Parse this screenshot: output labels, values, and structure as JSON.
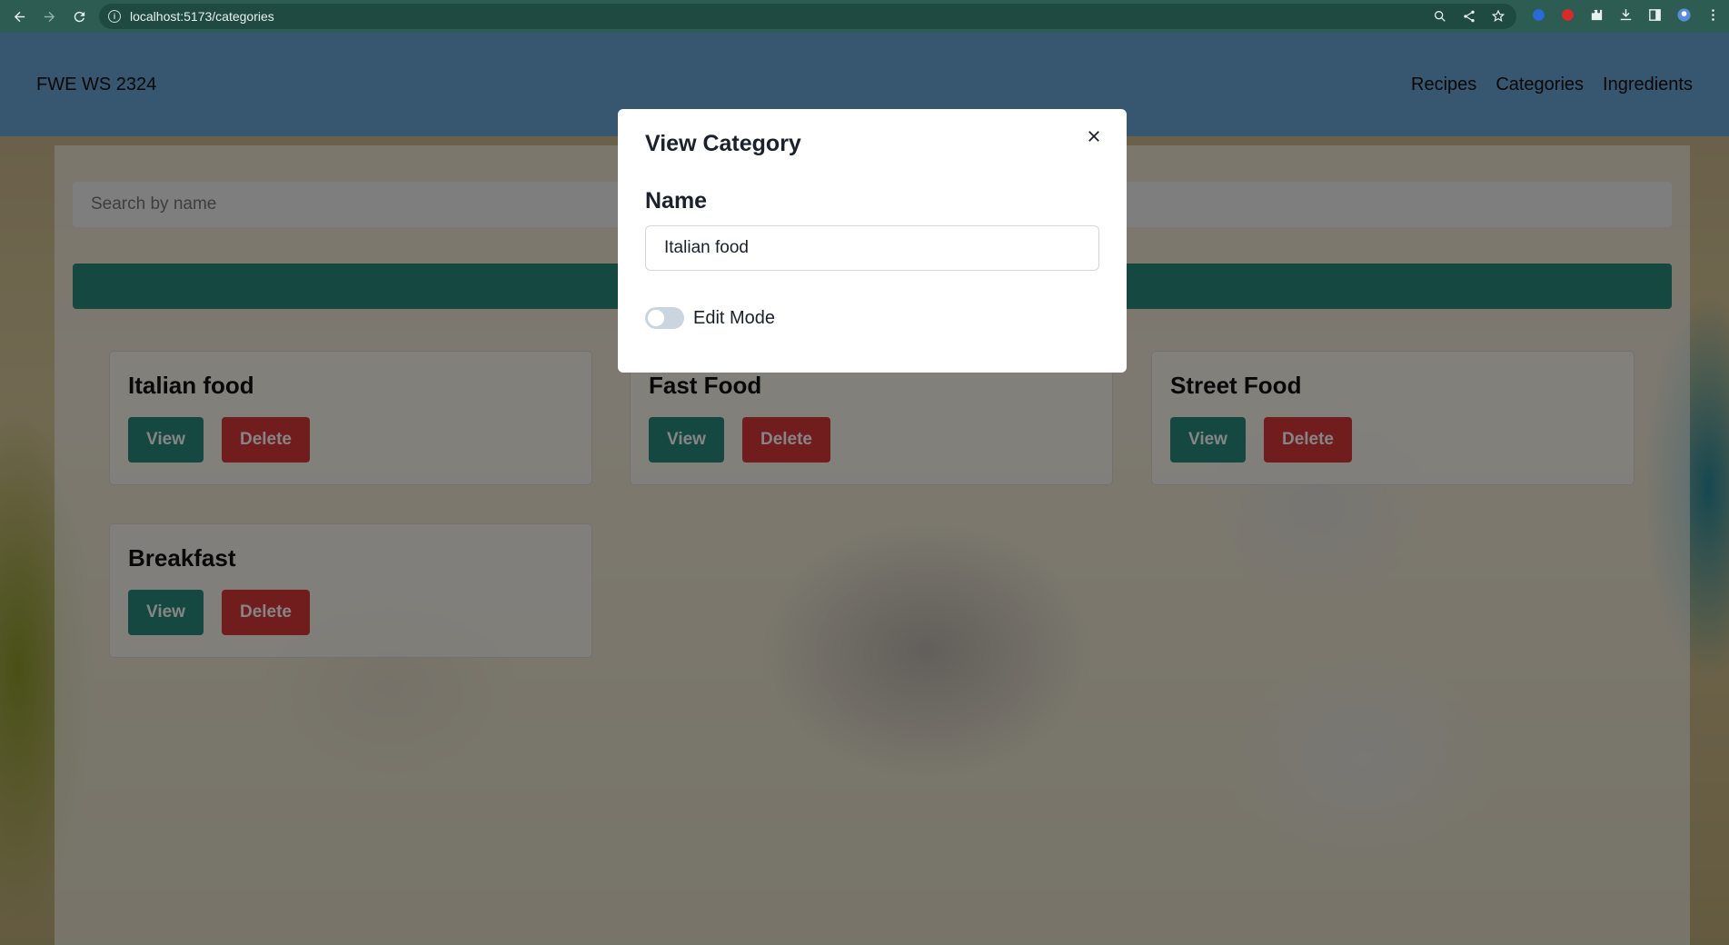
{
  "browser": {
    "url": "localhost:5173/categories"
  },
  "header": {
    "brand": "FWE WS 2324",
    "nav": [
      "Recipes",
      "Categories",
      "Ingredients"
    ]
  },
  "search": {
    "placeholder": "Search by name"
  },
  "categories": [
    {
      "name": "Italian food",
      "view_label": "View",
      "delete_label": "Delete"
    },
    {
      "name": "Fast Food",
      "view_label": "View",
      "delete_label": "Delete"
    },
    {
      "name": "Street Food",
      "view_label": "View",
      "delete_label": "Delete"
    },
    {
      "name": "Breakfast",
      "view_label": "View",
      "delete_label": "Delete"
    }
  ],
  "modal": {
    "title": "View Category",
    "name_label": "Name",
    "name_value": "Italian food",
    "toggle_label": "Edit Mode",
    "edit_mode": false
  },
  "colors": {
    "header": "#6aa6d6",
    "primary": "#2a8a7e",
    "danger": "#d93838"
  }
}
